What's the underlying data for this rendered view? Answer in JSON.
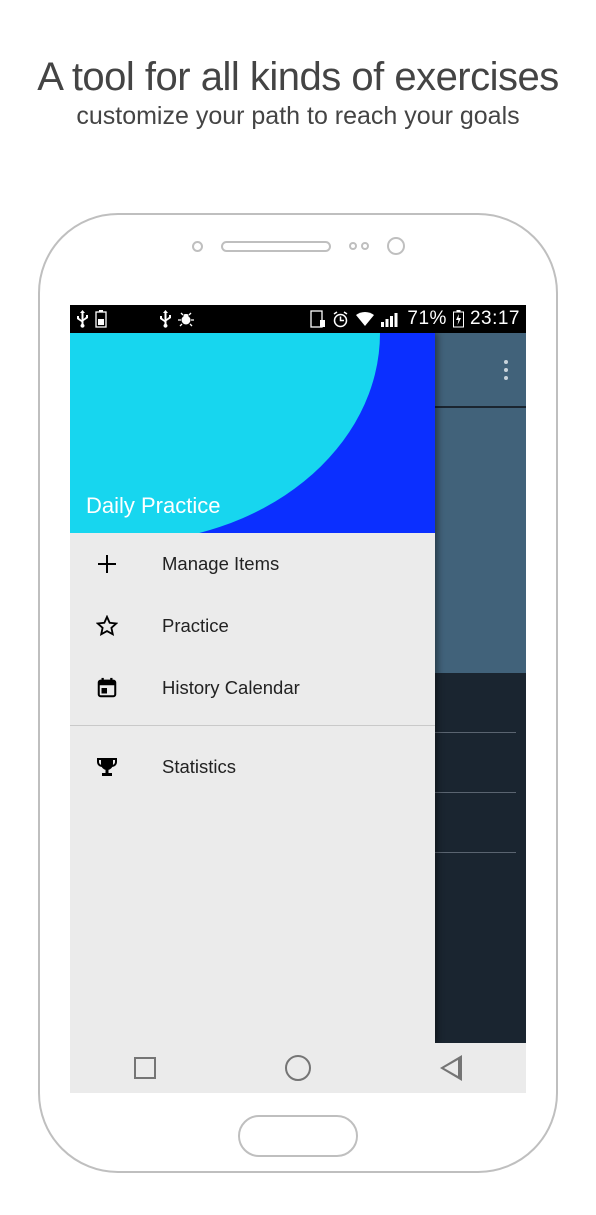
{
  "promo": {
    "headline": "A tool for all kinds of exercises",
    "subhead": "customize your path to reach your goals"
  },
  "statusbar": {
    "battery_pct": "71%",
    "time": "23:17"
  },
  "drawer": {
    "title": "Daily Practice",
    "items": [
      {
        "label": "Manage Items"
      },
      {
        "label": "Practice"
      },
      {
        "label": "History Calendar"
      },
      {
        "label": "Statistics"
      }
    ]
  }
}
